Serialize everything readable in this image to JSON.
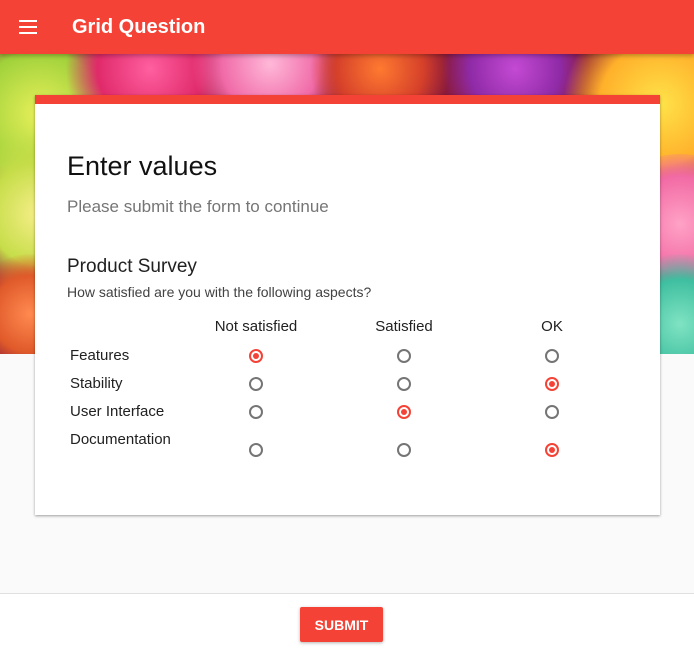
{
  "appbar": {
    "menu_icon": "menu-icon",
    "title": "Grid Question"
  },
  "colors": {
    "primary": "#f44336",
    "background": "#fafafa"
  },
  "form": {
    "title": "Enter values",
    "description": "Please submit the form to continue"
  },
  "question": {
    "title": "Product Survey",
    "help": "How satisfied are you with the following aspects?",
    "columns": [
      "Not satisfied",
      "Satisfied",
      "OK"
    ],
    "rows": [
      {
        "label": "Features",
        "selected": "Not satisfied"
      },
      {
        "label": "Stability",
        "selected": "OK"
      },
      {
        "label": "User Interface",
        "selected": "Satisfied"
      },
      {
        "label": "Documentation",
        "selected": "OK"
      }
    ]
  },
  "footer": {
    "submit_label": "SUBMIT"
  }
}
